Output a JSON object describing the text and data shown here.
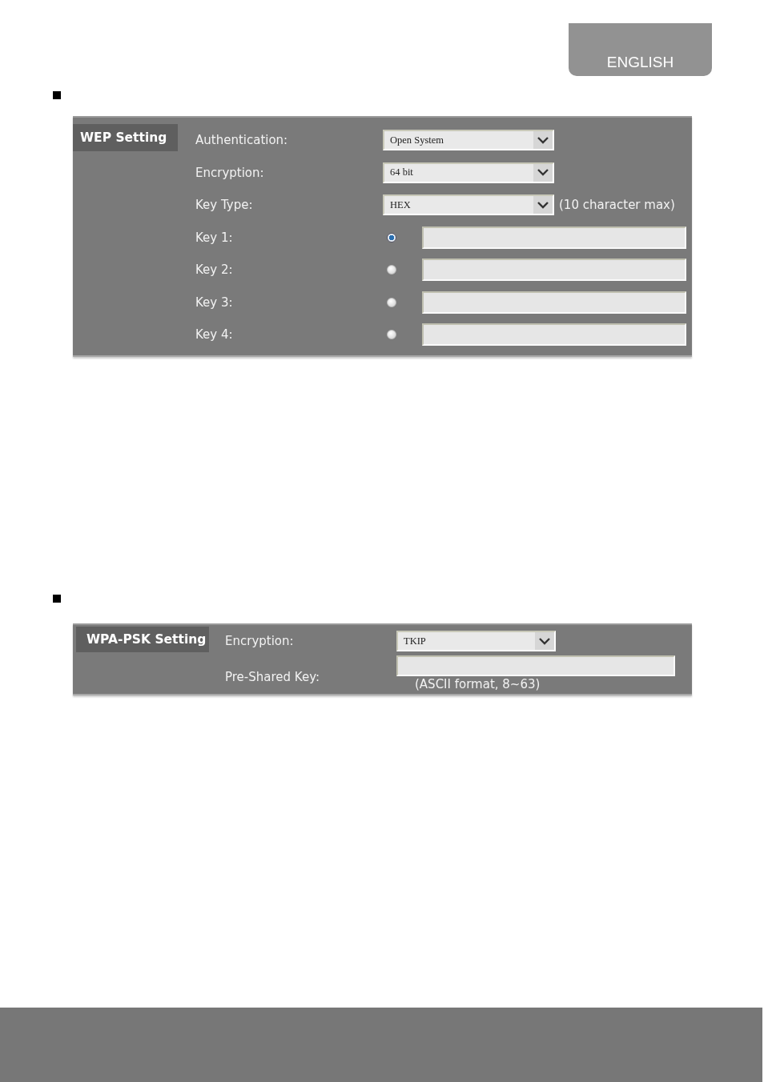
{
  "language_tab": "ENGLISH",
  "wep_setting": {
    "title": "WEP Setting",
    "authentication": {
      "label": "Authentication:",
      "value": "Open System"
    },
    "encryption": {
      "label": "Encryption:",
      "value": "64 bit"
    },
    "key_type": {
      "label": "Key Type:",
      "value": "HEX",
      "hint": "(10 character max)"
    },
    "keys": [
      {
        "label": "Key 1:",
        "selected": true
      },
      {
        "label": "Key 2:",
        "selected": false
      },
      {
        "label": "Key 3:",
        "selected": false
      },
      {
        "label": "Key 4:",
        "selected": false
      }
    ]
  },
  "wpa_psk_setting": {
    "title": "WPA-PSK Setting",
    "encryption": {
      "label": "Encryption:",
      "value": "TKIP"
    },
    "pre_shared_key": {
      "label": "Pre-Shared Key:",
      "hint": "(ASCII format, 8~63)"
    }
  }
}
